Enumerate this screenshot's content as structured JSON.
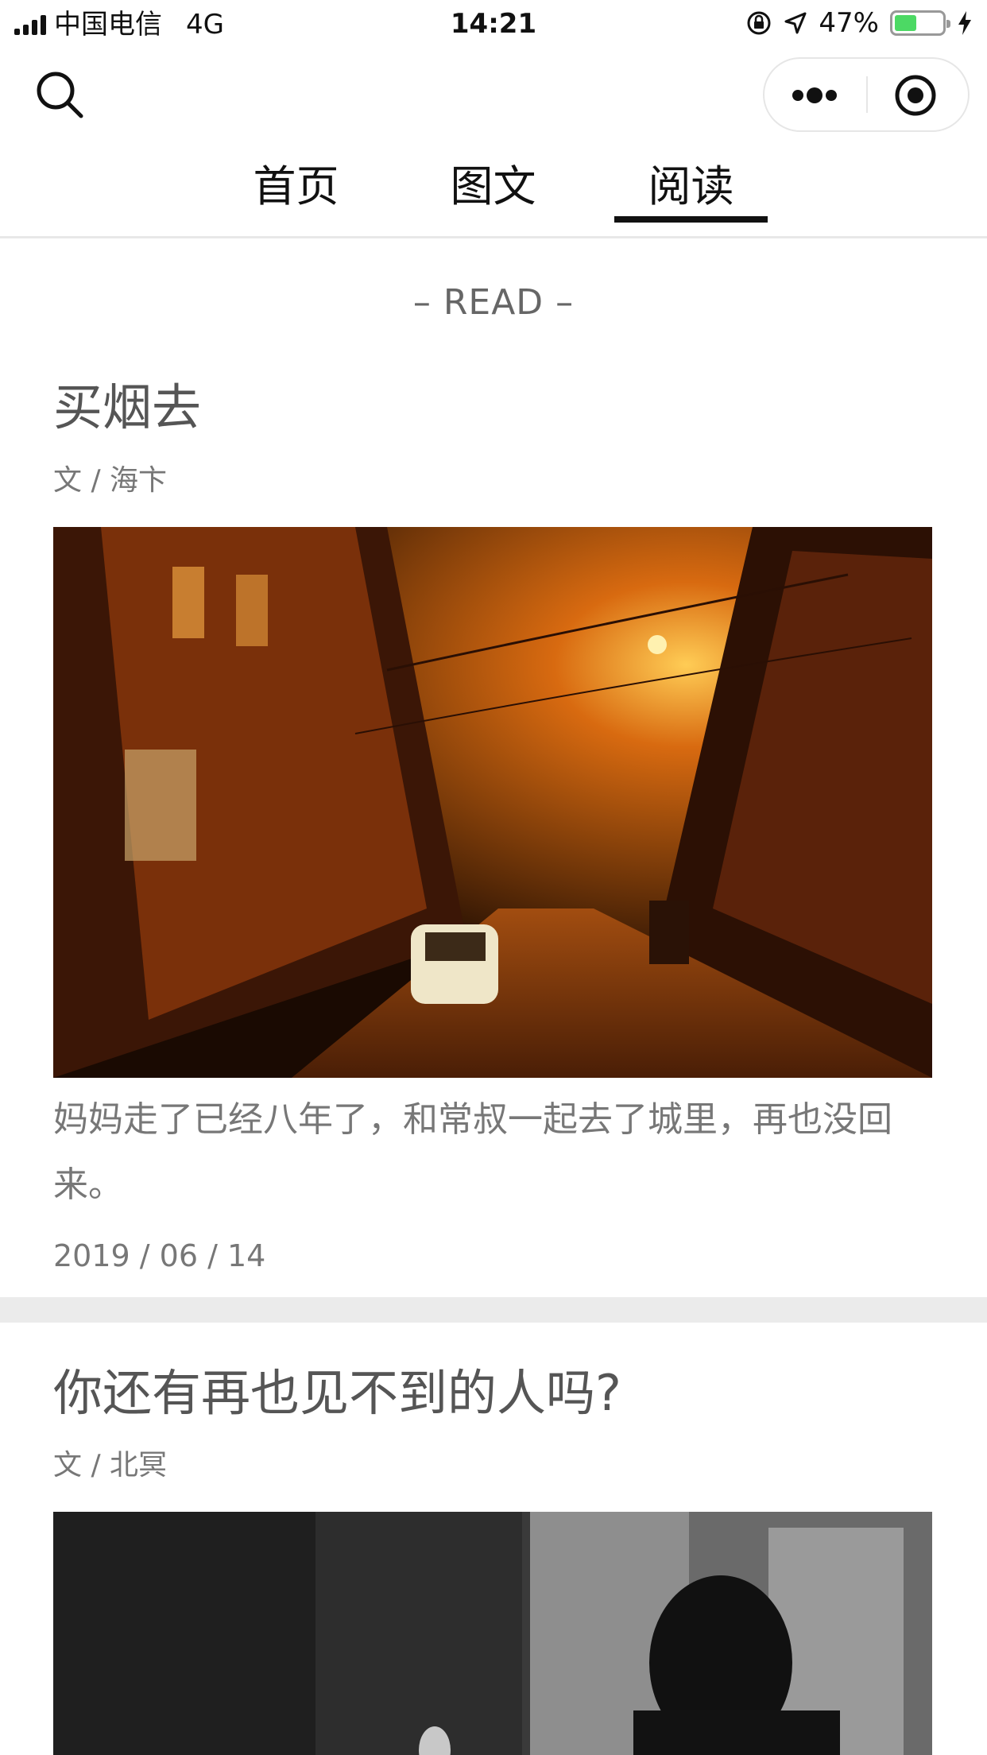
{
  "status_bar": {
    "carrier": "中国电信",
    "network": "4G",
    "time": "14:21",
    "battery_percent": "47%",
    "battery_level": 0.47,
    "battery_color": "#4cd964"
  },
  "nav": {
    "search_icon": "search-icon",
    "more_icon": "more-dots-icon",
    "close_icon": "target-circle-icon"
  },
  "tabs": [
    {
      "label": "首页",
      "active": false
    },
    {
      "label": "图文",
      "active": false
    },
    {
      "label": "阅读",
      "active": true
    }
  ],
  "section_label": "– READ –",
  "articles": [
    {
      "title": "买烟去",
      "author": "文 / 海卞",
      "excerpt": "妈妈走了已经八年了，和常叔一起去了城里，再也没回来。",
      "date": "2019 / 06 / 14"
    },
    {
      "title": "你还有再也见不到的人吗?",
      "author": "文 / 北冥"
    }
  ]
}
